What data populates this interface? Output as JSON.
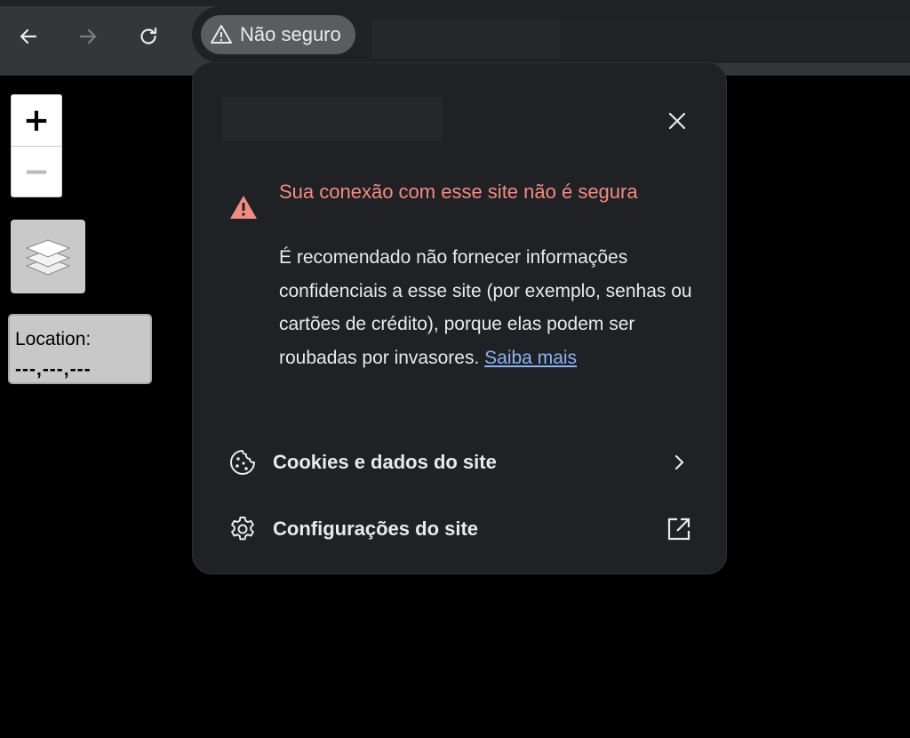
{
  "browser": {
    "nav": {
      "back_icon": "arrow-left-icon",
      "forward_icon": "arrow-right-icon",
      "reload_icon": "reload-icon"
    },
    "security_chip": {
      "icon": "warning-triangle-icon",
      "label": "Não seguro"
    }
  },
  "map": {
    "zoom_in_label": "+",
    "zoom_out_label": "−",
    "layers_icon": "layers-icon",
    "location": {
      "label": "Location:",
      "value": "---,---,---"
    }
  },
  "popup": {
    "close_icon": "close-icon",
    "warning": {
      "icon": "warning-triangle-icon",
      "title": "Sua conexão com esse site não é segura",
      "body": "É recomendado não fornecer informações confidenciais a esse site (por exemplo, senhas ou cartões de crédito), porque elas podem ser roubadas por invasores.",
      "link_label": "Saiba mais"
    },
    "rows": [
      {
        "icon": "cookie-icon",
        "label": "Cookies e dados do site",
        "trailing_icon": "chevron-right-icon"
      },
      {
        "icon": "gear-icon",
        "label": "Configurações do site",
        "trailing_icon": "open-external-icon"
      }
    ]
  },
  "colors": {
    "warning_red": "#f28b82",
    "link_blue": "#8ab4f8",
    "popup_bg": "#202124"
  }
}
